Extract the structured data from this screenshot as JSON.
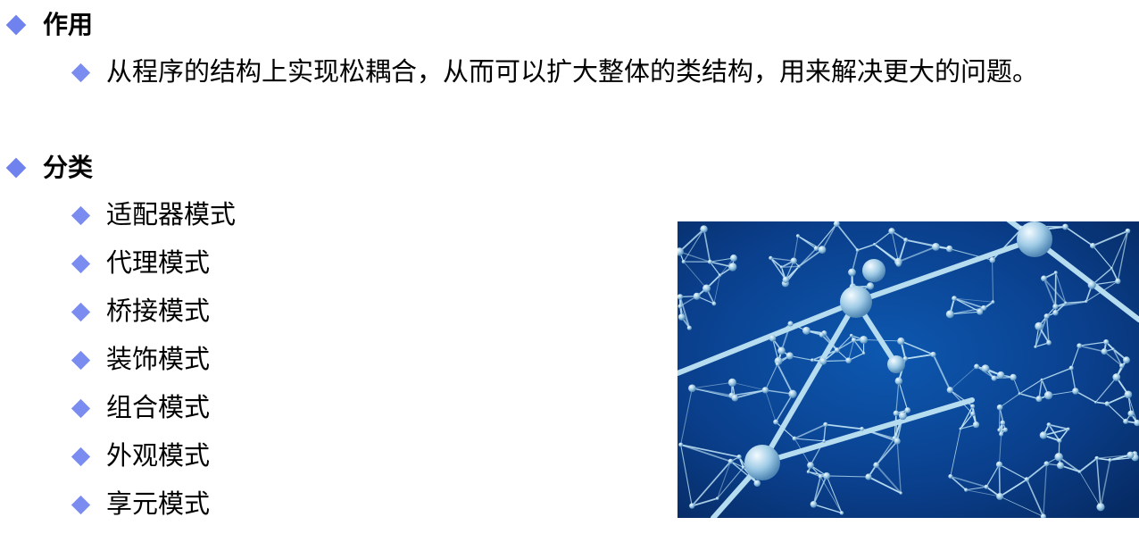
{
  "section_purpose": {
    "title": "作用",
    "items": [
      "从程序的结构上实现松耦合，从而可以扩大整体的类结构，用来解决更大的问题。"
    ]
  },
  "section_categories": {
    "title": "分类",
    "items": [
      "适配器模式",
      "代理模式",
      "桥接模式",
      "装饰模式",
      "组合模式",
      "外观模式",
      "享元模式"
    ]
  },
  "colors": {
    "bullet": "#7b8cf0",
    "image_background": "#0a3f8c",
    "network_lines": "#bfe3f5"
  },
  "icons": {
    "bullet": "diamond-bullet-icon",
    "image": "molecular-network-image"
  }
}
